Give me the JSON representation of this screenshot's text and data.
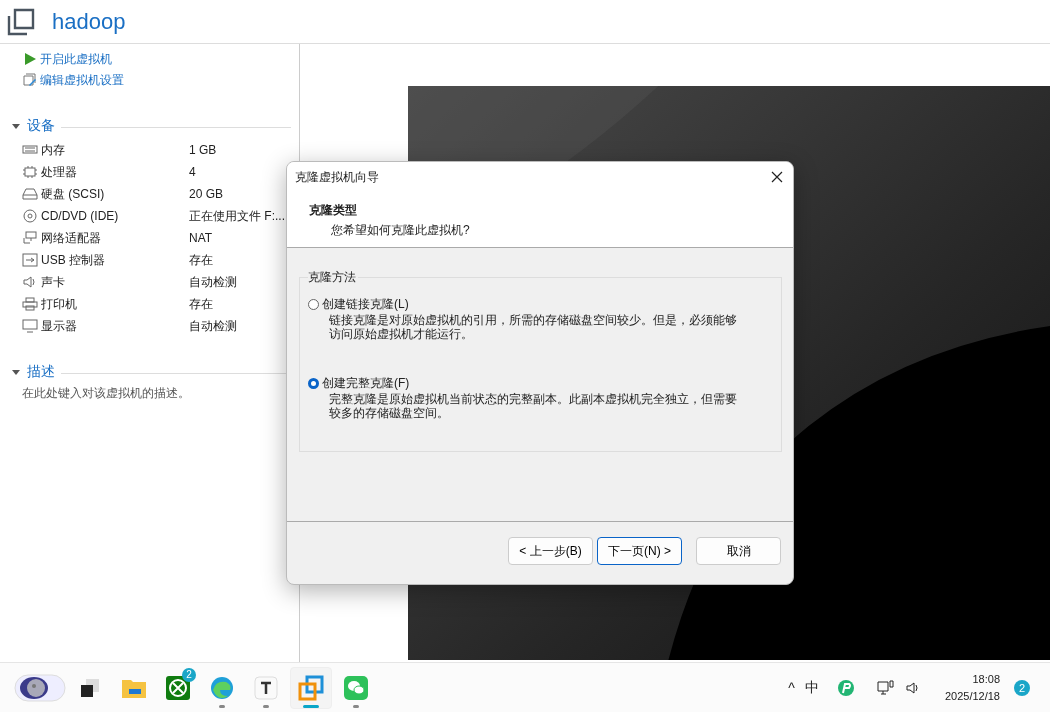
{
  "window": {
    "title": "hadoop"
  },
  "actions": [
    {
      "label": "开启此虚拟机",
      "kind": "play"
    },
    {
      "label": "编辑虚拟机设置",
      "kind": "edit"
    }
  ],
  "devices": {
    "heading": "设备",
    "expanded": true,
    "items": [
      {
        "name": "内存",
        "value": "1 GB",
        "kind": "memory"
      },
      {
        "name": "处理器",
        "value": "4",
        "kind": "cpu"
      },
      {
        "name": "硬盘 (SCSI)",
        "value": "20 GB",
        "kind": "disk"
      },
      {
        "name": "CD/DVD (IDE)",
        "value": "正在使用文件 F:...",
        "kind": "cd"
      },
      {
        "name": "网络适配器",
        "value": "NAT",
        "kind": "network"
      },
      {
        "name": "USB 控制器",
        "value": "存在",
        "kind": "usb"
      },
      {
        "name": "声卡",
        "value": "自动检测",
        "kind": "sound"
      },
      {
        "name": "打印机",
        "value": "存在",
        "kind": "printer"
      },
      {
        "name": "显示器",
        "value": "自动检测",
        "kind": "display"
      }
    ]
  },
  "description": {
    "heading": "描述",
    "expanded": true,
    "placeholder": "在此处键入对该虚拟机的描述。"
  },
  "dialog": {
    "title": "克隆虚拟机向导",
    "heading": "克隆类型",
    "subheading": "您希望如何克隆此虚拟机?",
    "group_label": "克隆方法",
    "options": [
      {
        "label": "创建链接克隆(L)",
        "description": "链接克隆是对原始虚拟机的引用，所需的存储磁盘空间较少。但是，必须能够访问原始虚拟机才能运行。",
        "selected": false
      },
      {
        "label": "创建完整克隆(F)",
        "description": "完整克隆是原始虚拟机当前状态的完整副本。此副本虚拟机完全独立，但需要较多的存储磁盘空间。",
        "selected": true
      }
    ],
    "buttons": [
      {
        "label": "< 上一步(B)",
        "default": false
      },
      {
        "label": "下一页(N) >",
        "default": true
      },
      {
        "label": "取消",
        "default": false
      }
    ]
  },
  "taskbar": {
    "apps": [
      {
        "kind": "widgets",
        "running": false,
        "active": false
      },
      {
        "kind": "taskview",
        "running": false,
        "active": false
      },
      {
        "kind": "explorer",
        "running": false,
        "active": false
      },
      {
        "kind": "xbox",
        "running": false,
        "active": false,
        "badge": "2"
      },
      {
        "kind": "edge",
        "running": true,
        "active": false
      },
      {
        "kind": "typora",
        "running": true,
        "active": false
      },
      {
        "kind": "vmware",
        "running": true,
        "active": true
      },
      {
        "kind": "wechat",
        "running": true,
        "active": false
      }
    ],
    "tray": {
      "chevron": "^",
      "ime": "中",
      "time": "18:08",
      "date": "2025/12/18",
      "notifications": "2"
    }
  }
}
